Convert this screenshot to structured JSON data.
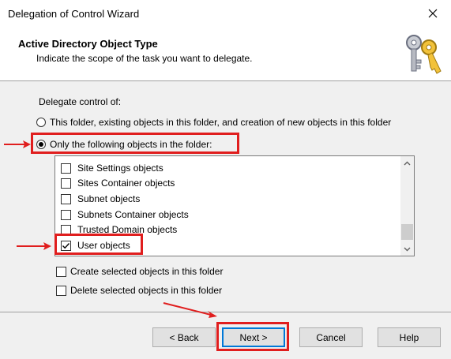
{
  "window": {
    "title": "Delegation of Control Wizard",
    "close_icon": "close-icon"
  },
  "header": {
    "title": "Active Directory Object Type",
    "subtitle": "Indicate the scope of the task you want to delegate."
  },
  "body": {
    "delegate_label": "Delegate control of:",
    "radio_options": [
      {
        "label": "This folder, existing objects in this folder, and creation of new objects in this folder",
        "checked": false
      },
      {
        "label": "Only the following objects in the folder:",
        "checked": true
      }
    ],
    "object_list": [
      {
        "label": "Site Settings objects",
        "checked": false
      },
      {
        "label": "Sites Container objects",
        "checked": false
      },
      {
        "label": "Subnet objects",
        "checked": false
      },
      {
        "label": "Subnets Container objects",
        "checked": false
      },
      {
        "label": "Trusted Domain objects",
        "checked": false
      },
      {
        "label": "User objects",
        "checked": true
      }
    ],
    "create_option": {
      "label": "Create selected objects in this folder",
      "checked": false
    },
    "delete_option": {
      "label": "Delete selected objects in this folder",
      "checked": false
    }
  },
  "footer": {
    "back_label": "< Back",
    "next_label": "Next >",
    "cancel_label": "Cancel",
    "help_label": "Help"
  },
  "annotation_color": "#e01e1e",
  "accent_color": "#0078d7"
}
